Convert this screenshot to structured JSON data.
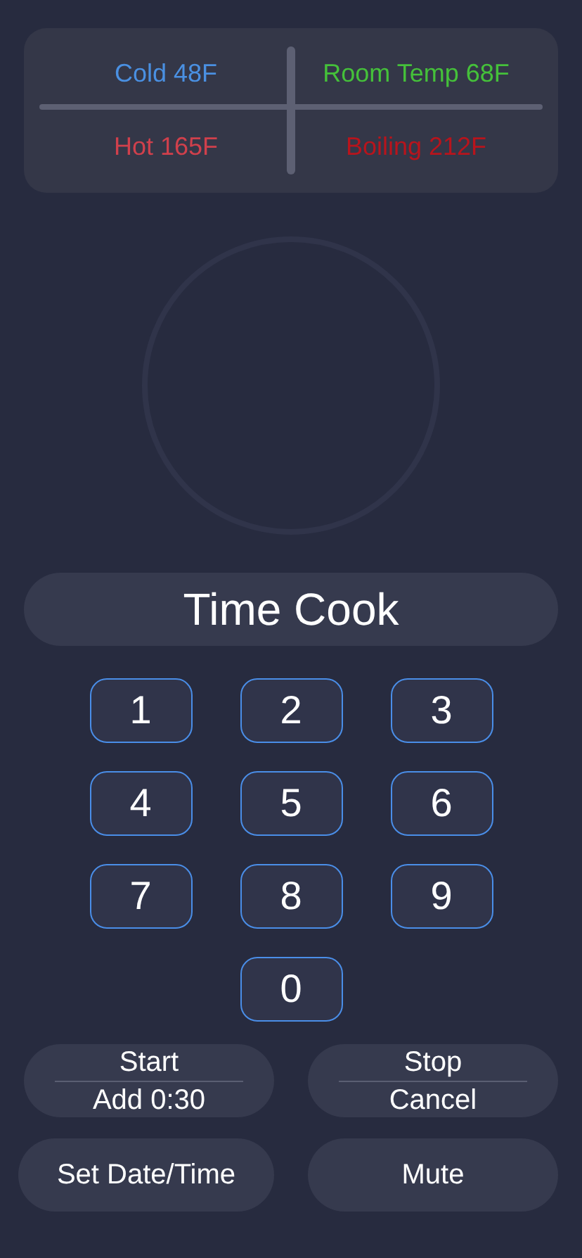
{
  "presets": [
    {
      "label": "Cold 48F",
      "color": "#4a90e2"
    },
    {
      "label": "Room Temp 68F",
      "color": "#45c13a"
    },
    {
      "label": "Hot 165F",
      "color": "#d0404c"
    },
    {
      "label": "Boiling 212F",
      "color": "#b8141c"
    }
  ],
  "mode_button": "Time Cook",
  "keypad": [
    "1",
    "2",
    "3",
    "4",
    "5",
    "6",
    "7",
    "8",
    "9",
    "0"
  ],
  "actions": [
    {
      "kind": "split",
      "top": "Start",
      "bottom": "Add 0:30"
    },
    {
      "kind": "split",
      "top": "Stop",
      "bottom": "Cancel"
    },
    {
      "kind": "single",
      "label": "Set Date/Time"
    },
    {
      "kind": "single",
      "label": "Mute"
    }
  ]
}
